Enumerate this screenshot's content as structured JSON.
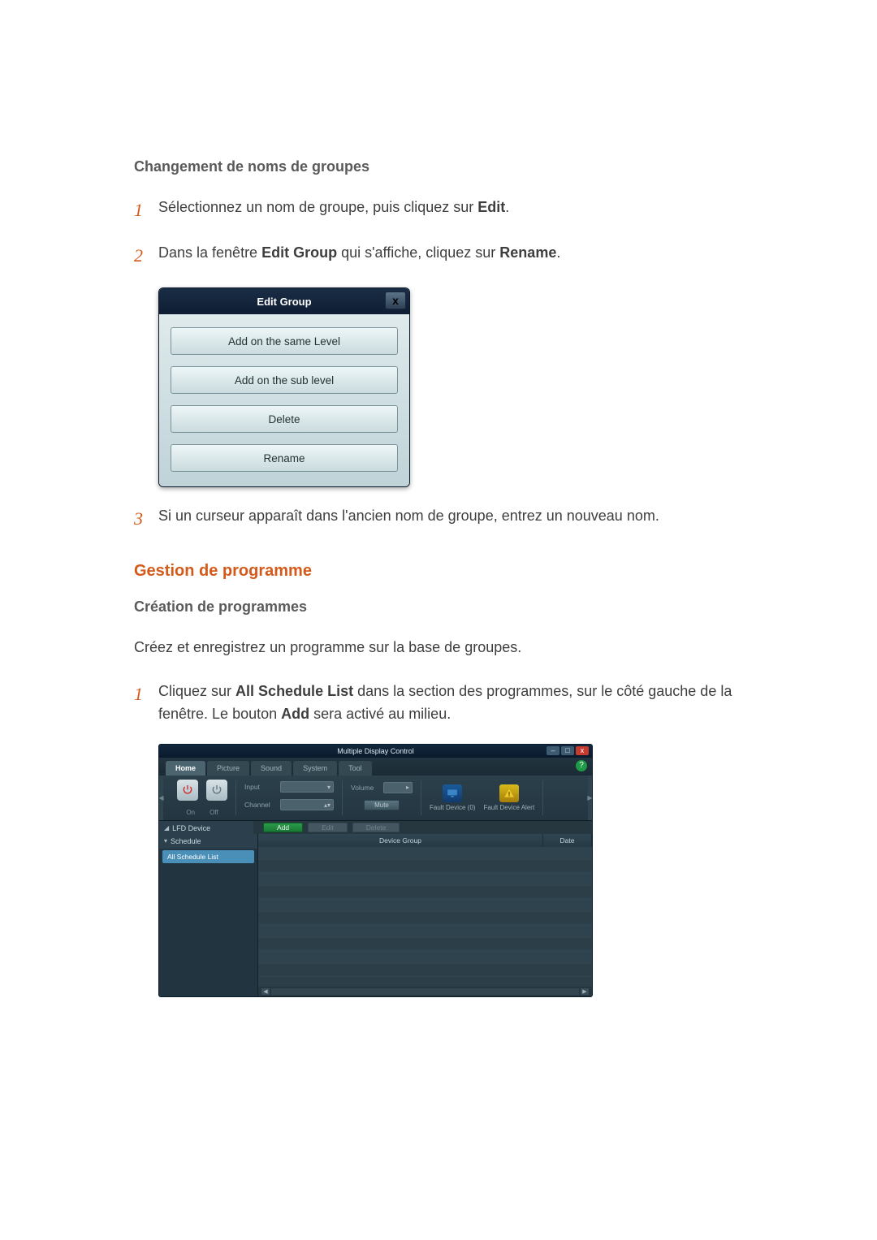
{
  "heading_change_group_names": "Changement de noms de groupes",
  "steps_a": [
    {
      "n": "1",
      "pre": "Sélectionnez un nom de groupe, puis cliquez sur ",
      "b": "Edit",
      "post": "."
    },
    {
      "n": "2",
      "pre": "Dans la fenêtre ",
      "b": "Edit Group",
      "mid": " qui s'affiche, cliquez sur ",
      "b2": "Rename",
      "post": "."
    }
  ],
  "dialog": {
    "title": "Edit Group",
    "close": "x",
    "buttons": [
      "Add on the same Level",
      "Add on the sub level",
      "Delete",
      "Rename"
    ]
  },
  "step_a3": {
    "n": "3",
    "text": "Si un curseur apparaît dans l'ancien nom de groupe, entrez un nouveau nom."
  },
  "heading_schedule_mgmt": "Gestion de programme",
  "heading_create_schedules": "Création de programmes",
  "create_intro": "Créez et enregistrez un programme sur la base de groupes.",
  "step_b1": {
    "n": "1",
    "pre": "Cliquez sur ",
    "b": "All Schedule List",
    "mid": " dans la section des programmes, sur le côté gauche de la fenêtre. Le bouton ",
    "b2": "Add",
    "post": " sera activé au milieu."
  },
  "mdc": {
    "title": "Multiple Display Control",
    "win": {
      "min": "–",
      "max": "□",
      "close": "x"
    },
    "help": "?",
    "tabs": [
      "Home",
      "Picture",
      "Sound",
      "System",
      "Tool"
    ],
    "ribbon": {
      "power": {
        "on": "On",
        "off": "Off"
      },
      "input": {
        "label": "Input",
        "channel_label": "Channel"
      },
      "volume": {
        "label": "Volume",
        "mute": "Mute"
      },
      "fault": {
        "d": "Fault Device (0)",
        "a": "Fault Device Alert"
      }
    },
    "actions": {
      "add": "Add",
      "edit": "Edit",
      "delete": "Delete"
    },
    "tree": {
      "lfd": "LFD Device",
      "schedule": "Schedule",
      "all": "All Schedule List"
    },
    "grid": {
      "col1": "Device Group",
      "col2": "Date"
    }
  }
}
